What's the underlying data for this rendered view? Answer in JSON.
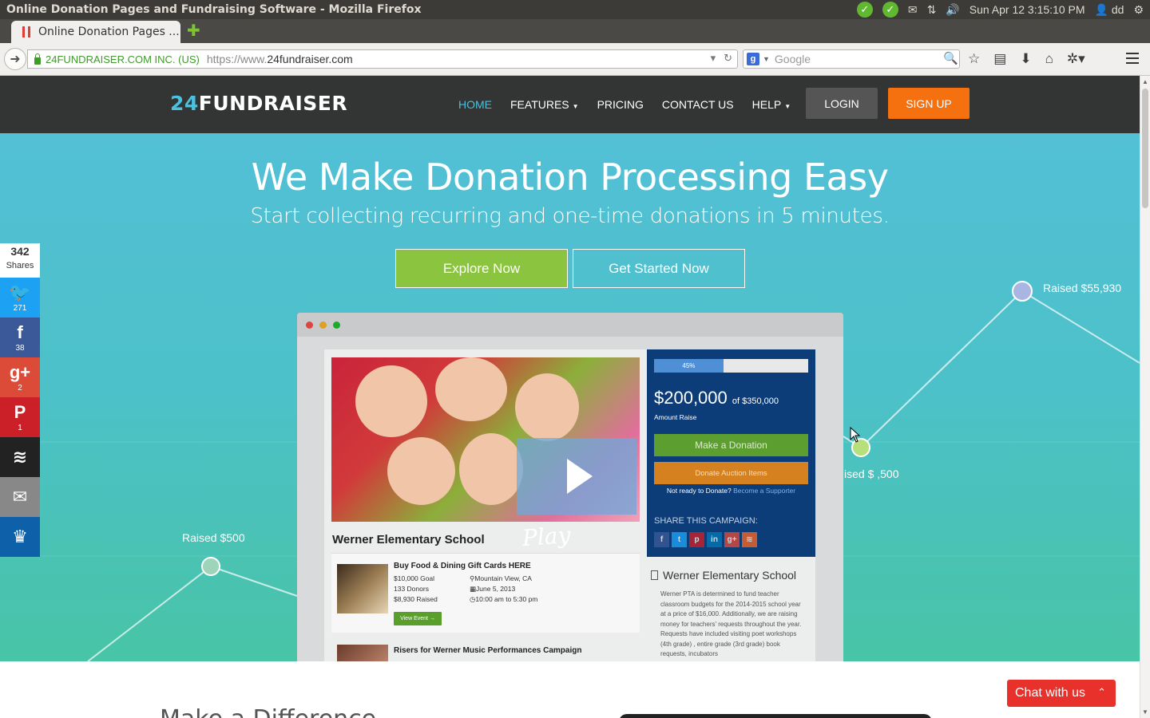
{
  "os": {
    "window_title": "Online Donation Pages and Fundraising Software - Mozilla Firefox",
    "clock": "Sun Apr 12  3:15:10 PM",
    "user": "dd"
  },
  "browser": {
    "tab_title": "Online Donation Pages ...",
    "site_identity": "24FUNDRAISER.COM INC. (US)",
    "url_scheme": "https://www.",
    "url_host": "24fundraiser.com",
    "search_placeholder": "Google",
    "search_engine_glyph": "g"
  },
  "site": {
    "logo_num": "24",
    "logo_text": "FUNDRAISER",
    "nav": [
      {
        "label": "HOME",
        "active": true
      },
      {
        "label": "FEATURES",
        "dropdown": true
      },
      {
        "label": "PRICING"
      },
      {
        "label": "CONTACT US"
      },
      {
        "label": "HELP",
        "dropdown": true
      }
    ],
    "login_label": "LOGIN",
    "signup_label": "SIGN UP",
    "colors": {
      "accent": "#49c1e0",
      "signup": "#f5700f",
      "explore": "#8bc53f",
      "header": "#333534"
    }
  },
  "hero": {
    "title": "We Make Donation Processing Easy",
    "subtitle": "Start collecting recurring and one-time donations in 5 minutes.",
    "explore_label": "Explore Now",
    "started_label": "Get Started Now",
    "raised_labels": [
      "Raised $55,930",
      "ised $ ,500",
      "Raised $500"
    ]
  },
  "social": {
    "total": "342",
    "total_label": "Shares",
    "items": [
      {
        "name": "twitter",
        "glyph": "🐦",
        "count": "271",
        "color": "#1da1f2"
      },
      {
        "name": "facebook",
        "glyph": "f",
        "count": "38",
        "color": "#3b5998"
      },
      {
        "name": "google-plus",
        "glyph": "g+",
        "count": "2",
        "color": "#dc4a38"
      },
      {
        "name": "pinterest",
        "glyph": "P",
        "count": "1",
        "color": "#cb2027"
      },
      {
        "name": "buffer",
        "glyph": "≋",
        "count": "",
        "color": "#222222"
      },
      {
        "name": "email",
        "glyph": "✉",
        "count": "",
        "color": "#888888"
      },
      {
        "name": "sumo",
        "glyph": "♛",
        "count": "",
        "color": "#0e60a8"
      }
    ]
  },
  "mockup": {
    "school_name": "Werner Elementary School",
    "play_video": "Play Video",
    "progress_label": "45%",
    "progress_value": 0.45,
    "amount": "$200,000",
    "amount_of": "of $350,000",
    "amount_label": "Amount Raise",
    "donate_label": "Make a Donation",
    "auction_label": "Donate Auction Items",
    "not_ready": "Not ready to Donate?",
    "become_supporter": "Become a Supporter",
    "share_label": "SHARE THIS CAMPAIGN:",
    "event1": {
      "title": "Buy Food & Dining Gift Cards HERE",
      "goal": "$10,000 Goal",
      "donors": "133 Donors",
      "raised": "$8,930 Raised",
      "location": "Mountain View, CA",
      "date": "June 5, 2013",
      "time": "10:00 am to 5:30 pm",
      "view_label": "View Event →"
    },
    "event2_title": "Risers for Werner Music Performances Campaign",
    "about_title": "Werner Elementary School",
    "about_text": "Werner PTA is determined to fund teacher classroom budgets for the 2014-2015 school year at a price of $16,000. Additionally, we are raising money for teachers' requests throughout the year. Requests have included visiting poet workshops (4th grade) , entire grade (3rd grade) book requests, incubators"
  },
  "below": {
    "heading": "Make a Difference"
  },
  "chat": {
    "label": "Chat with us"
  }
}
